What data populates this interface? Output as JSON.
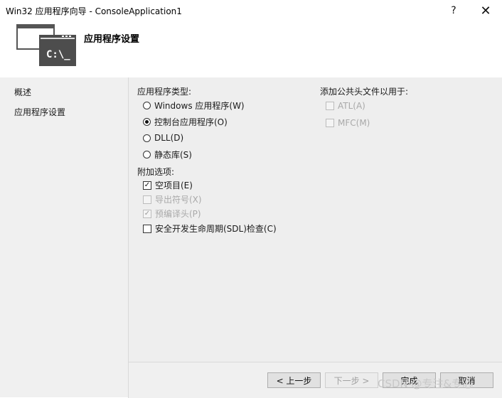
{
  "window": {
    "title": "Win32 应用程序向导 - ConsoleApplication1",
    "help_glyph": "?",
    "close_glyph": "✕"
  },
  "header": {
    "title": "应用程序设置",
    "icon_text": "C:\\_"
  },
  "sidebar": {
    "items": [
      {
        "label": "概述"
      },
      {
        "label": "应用程序设置"
      }
    ]
  },
  "app_type": {
    "label": "应用程序类型:",
    "options": [
      {
        "label": "Windows 应用程序(W)",
        "checked": false
      },
      {
        "label": "控制台应用程序(O)",
        "checked": true
      },
      {
        "label": "DLL(D)",
        "checked": false
      },
      {
        "label": "静态库(S)",
        "checked": false
      }
    ]
  },
  "additional": {
    "label": "附加选项:",
    "options": [
      {
        "label": "空项目(E)",
        "checked": true,
        "disabled": false
      },
      {
        "label": "导出符号(X)",
        "checked": false,
        "disabled": true
      },
      {
        "label": "预编译头(P)",
        "checked": true,
        "disabled": true
      },
      {
        "label": "安全开发生命周期(SDL)检查(C)",
        "checked": false,
        "disabled": false
      }
    ]
  },
  "common_headers": {
    "label": "添加公共头文件以用于:",
    "options": [
      {
        "label": "ATL(A)",
        "checked": false,
        "disabled": true
      },
      {
        "label": "MFC(M)",
        "checked": false,
        "disabled": true
      }
    ]
  },
  "footer": {
    "back_label": "< 上一步",
    "next_label": "下一步 >",
    "finish_label": "完成",
    "cancel_label": "取消"
  },
  "watermark": "CSDN @专注&专心"
}
